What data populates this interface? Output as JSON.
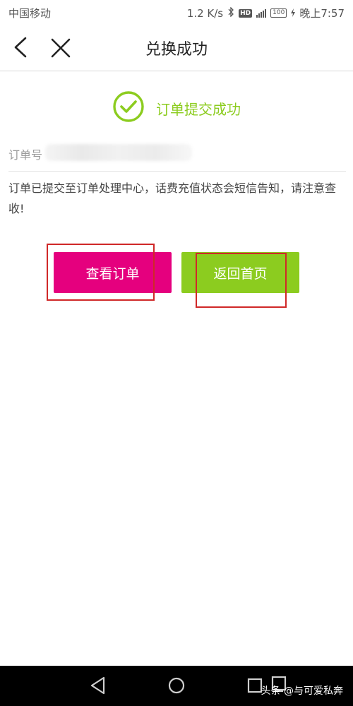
{
  "status_bar": {
    "carrier": "中国移动",
    "speed": "1.2 K/s",
    "network": "HD",
    "battery": "100",
    "time": "晚上7:57"
  },
  "nav": {
    "title": "兑换成功"
  },
  "success": {
    "label": "订单提交成功"
  },
  "order": {
    "label": "订单号"
  },
  "message": "订单已提交至订单处理中心，话费充值状态会短信告知，请注意查收!",
  "buttons": {
    "view_order": "查看订单",
    "back_home": "返回首页"
  },
  "watermark": "头条 @与可爱私奔",
  "colors": {
    "success_green": "#8ccc1f",
    "view_order_magenta": "#e5007e",
    "highlight_red": "#d02828"
  }
}
